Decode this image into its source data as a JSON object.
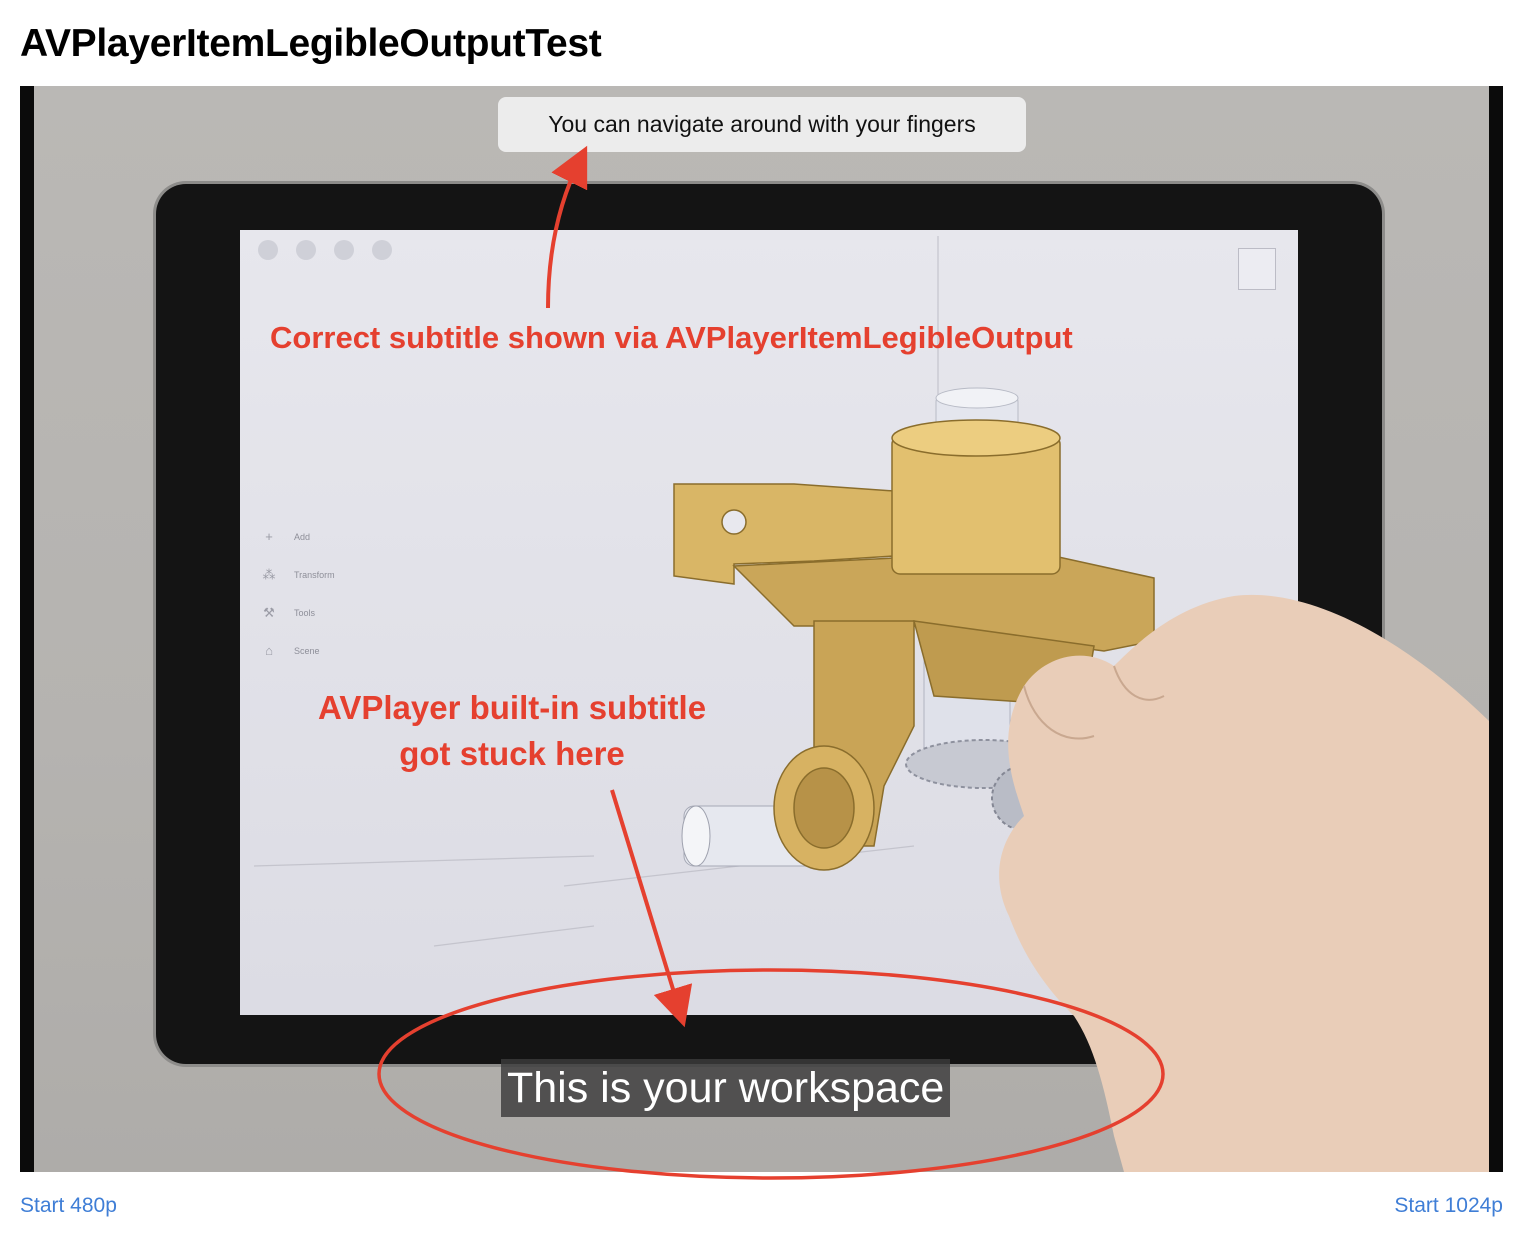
{
  "page": {
    "title": "AVPlayerItemLegibleOutputTest"
  },
  "video": {
    "legible_output_subtitle": "You can navigate around with your fingers",
    "builtin_subtitle": "This is your workspace",
    "app_menu": {
      "items": [
        {
          "icon": "plus-icon",
          "label": "Add"
        },
        {
          "icon": "transform-icon",
          "label": "Transform"
        },
        {
          "icon": "tools-icon",
          "label": "Tools"
        },
        {
          "icon": "scene-icon",
          "label": "Scene"
        }
      ]
    }
  },
  "annotations": {
    "top_label": "Correct subtitle shown via AVPlayerItemLegibleOutput",
    "bottom_label_line1": "AVPlayer built-in subtitle",
    "bottom_label_line2": "got stuck here",
    "color": "#e5402f"
  },
  "controls": {
    "start_480_label": "Start 480p",
    "start_1024_label": "Start 1024p",
    "link_color": "#3f7ed6"
  }
}
